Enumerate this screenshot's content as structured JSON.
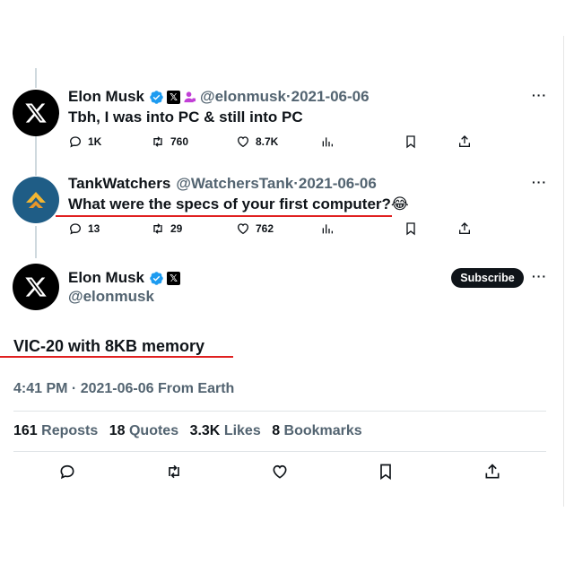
{
  "tweets": [
    {
      "name": "Elon Musk",
      "handle": "@elonmusk",
      "date": "2021-06-06",
      "text": "Tbh, I was into PC & still into PC",
      "stats": {
        "replies": "1K",
        "reposts": "760",
        "likes": "8.7K"
      }
    },
    {
      "name": "TankWatchers",
      "handle": "@WatchersTank",
      "date": "2021-06-06",
      "text": "What were the specs of your first computer?",
      "emoji": "😂",
      "stats": {
        "replies": "13",
        "reposts": "29",
        "likes": "762"
      }
    }
  ],
  "main_tweet": {
    "name": "Elon Musk",
    "handle": "@elonmusk",
    "subscribe_label": "Subscribe",
    "text": "VIC-20 with 8KB memory",
    "meta": "4:41 PM · 2021-06-06 From Earth",
    "stats": [
      {
        "num": "161",
        "label": "Reposts"
      },
      {
        "num": "18",
        "label": "Quotes"
      },
      {
        "num": "3.3K",
        "label": "Likes"
      },
      {
        "num": "8",
        "label": "Bookmarks"
      }
    ]
  },
  "separator": "·",
  "more_label": "···",
  "colors": {
    "verified": "#1d9bf0",
    "underline": "#e02020",
    "muted": "#536471",
    "text": "#0f1419",
    "purple_badge": "#c13fd6"
  },
  "icons": [
    "reply-icon",
    "repost-icon",
    "like-icon",
    "views-icon",
    "bookmark-icon",
    "share-icon",
    "verified-icon",
    "x-logo-icon",
    "more-icon"
  ]
}
